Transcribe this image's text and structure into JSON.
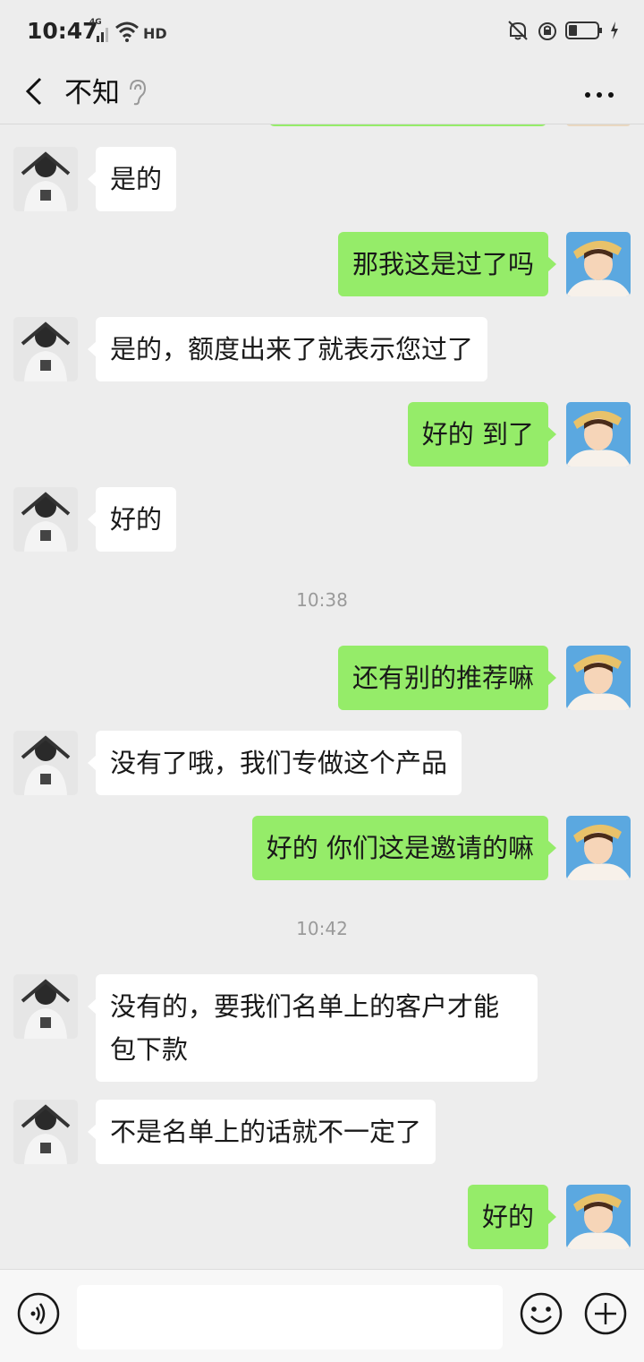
{
  "status_bar": {
    "time": "10:47",
    "network": "4G",
    "wifi_badge": "HD",
    "icons": [
      "mute-icon",
      "alarm-icon",
      "battery-icon",
      "charging-icon"
    ]
  },
  "header": {
    "title": "不知",
    "icons": [
      "back-arrow-icon",
      "earpiece-mode-icon",
      "more-options-icon"
    ]
  },
  "messages": [
    {
      "side": "in",
      "text": "是的"
    },
    {
      "side": "out",
      "text": "那我这是过了吗"
    },
    {
      "side": "in",
      "text": "是的，额度出来了就表示您过了"
    },
    {
      "side": "out",
      "text": "好的 到了"
    },
    {
      "side": "in",
      "text": "好的"
    },
    {
      "type": "time",
      "text": "10:38"
    },
    {
      "side": "out",
      "text": "还有别的推荐嘛"
    },
    {
      "side": "in",
      "text": "没有了哦，我们专做这个产品"
    },
    {
      "side": "out",
      "text": "好的 你们这是邀请的嘛"
    },
    {
      "type": "time",
      "text": "10:42"
    },
    {
      "side": "in",
      "text": "没有的，要我们名单上的客户才能包下款"
    },
    {
      "side": "in",
      "text": "不是名单上的话就不一定了"
    },
    {
      "side": "out",
      "text": "好的"
    }
  ],
  "input_bar": {
    "value": "",
    "icons": [
      "voice-icon",
      "emoji-icon",
      "plus-icon"
    ]
  },
  "colors": {
    "background": "#ededed",
    "outgoing_bubble": "#95ec69",
    "incoming_bubble": "#ffffff",
    "timestamp_text": "#9a9a9a"
  }
}
